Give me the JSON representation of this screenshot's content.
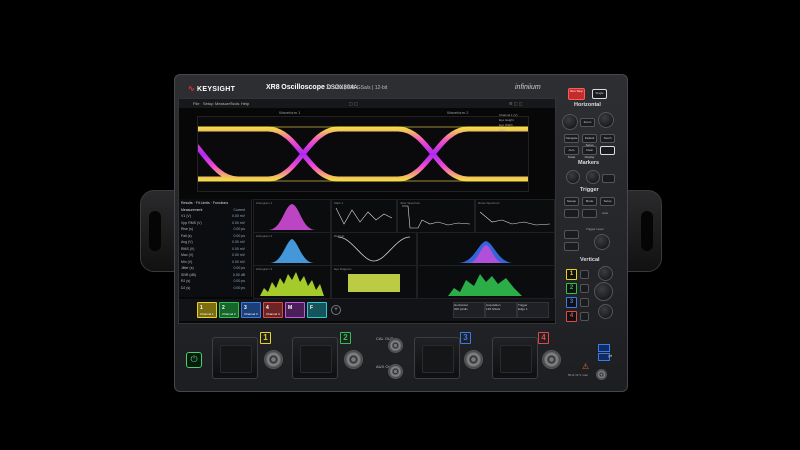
{
  "brand": {
    "company": "KEYSIGHT",
    "series": "XR8",
    "product": "Oscilloscope",
    "model": "DSOX804A",
    "bandwidth": "33 GHz",
    "sample_rate": "128 GSa/s",
    "bits": "12-bit",
    "infiniium": "infiniium"
  },
  "menu": {
    "items": [
      "File",
      "Setup",
      "Measure",
      "Tools",
      "Help"
    ],
    "waveform1": "Waveform 1",
    "waveform2": "Waveform 2"
  },
  "eye_info": {
    "lines": [
      "Channel 1 (V)",
      "Eye Height",
      "Eye Width",
      "Jitter"
    ]
  },
  "measurements": {
    "header_tabs": [
      "Results",
      "Fit Limits",
      "Functions"
    ],
    "col_measurement": "Measurement",
    "col_current": "Current",
    "rows": [
      [
        "V1 (V)",
        "0.00 mV"
      ],
      [
        "Vpp RMS (V)",
        "0.00 mV"
      ],
      [
        "Rise (s)",
        "0.00 ps"
      ],
      [
        "Fall (s)",
        "0.00 ps"
      ],
      [
        "Avg (V)",
        "0.00 mV"
      ],
      [
        "RMS (V)",
        "0.00 mV"
      ],
      [
        "Max (V)",
        "0.00 mV"
      ],
      [
        "Min (V)",
        "0.00 mV"
      ],
      [
        "Jitter (s)",
        "0.00 ps"
      ],
      [
        "SNR (dB)",
        "0.00 dB"
      ],
      [
        "RJ (s)",
        "0.00 ps"
      ],
      [
        "DJ (s)",
        "0.00 ps"
      ]
    ]
  },
  "plots": {
    "histogram1": "Histogram 1",
    "histogram2": "Histogram 2",
    "histogram3": "Histogram 3",
    "jitter": "Jitter Spectrum",
    "noise": "Noise Spectrum",
    "eye": "Eye Diagram",
    "bathtub": "Bathtub",
    "center": "Math 1"
  },
  "bottom": {
    "channels": [
      {
        "n": "1",
        "t": "Channel 1",
        "color": "#e7d320"
      },
      {
        "n": "2",
        "t": "Channel 2",
        "color": "#2fbf4f"
      },
      {
        "n": "3",
        "t": "Channel 3",
        "color": "#3a7be8"
      },
      {
        "n": "4",
        "t": "Channel 4",
        "color": "#e04848"
      }
    ],
    "horizontal": "Horizontal",
    "acquisition": "Acquisition",
    "trigger": "Trigger",
    "time_val": "200 ps/div",
    "rate_val": "128 GSa/s",
    "trig_val": "Edge 1"
  },
  "controls": {
    "run_stop": "Run\nStop",
    "single": "Single",
    "horizontal": "Horizontal",
    "zoom": "Zoom",
    "markers": "Markers",
    "trigger": "Trigger",
    "trigger_level": "Trigger Level",
    "vertical": "Vertical",
    "auto": "Auto",
    "force": "Force",
    "h_buttons": [
      "Zoom",
      "Navigate",
      "Default Setup",
      "Touch",
      "Auto Scale",
      "Clear Display"
    ],
    "trig_buttons": [
      "Sweep",
      "Mode",
      "Setup"
    ],
    "ch_labels": [
      "1",
      "2",
      "3",
      "4"
    ]
  },
  "front": {
    "aux_out": "CAL OUT",
    "aux_in": "AUX OUT",
    "ch_numbers": [
      "1",
      "2",
      "3",
      "4"
    ],
    "warning": "50 Ω  ±2 V max"
  }
}
